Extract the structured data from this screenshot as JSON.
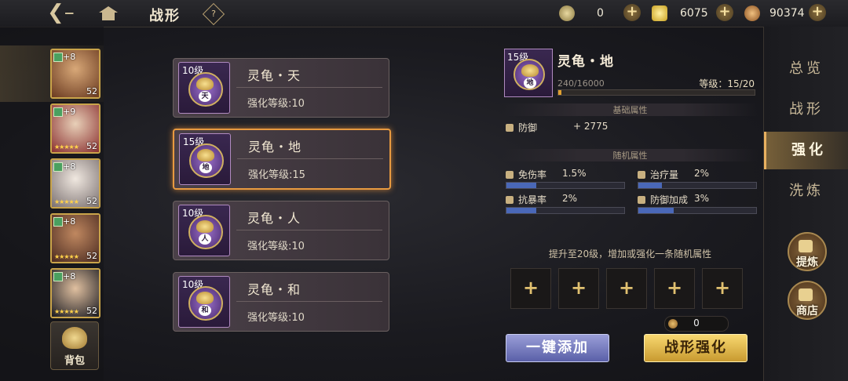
{
  "header": {
    "title": "战形",
    "help": "?",
    "currencies": [
      {
        "icon": "token-icon",
        "value": "0",
        "color": "#b0a070"
      },
      {
        "icon": "gold-ingot-icon",
        "value": "6075",
        "color": "#e8c040"
      },
      {
        "icon": "copper-coin-icon",
        "value": "90374",
        "color": "#c08040"
      }
    ]
  },
  "heroes": [
    {
      "bonus": "+8",
      "level": "52",
      "stars": "★★★★★",
      "color": "#b07a50",
      "selected": true
    },
    {
      "bonus": "+9",
      "level": "52",
      "stars": "★★★★★",
      "color": "#c0b8b0"
    },
    {
      "bonus": "+8",
      "level": "52",
      "stars": "★★★★★",
      "color": "#d8d0c8"
    },
    {
      "bonus": "+8",
      "level": "52",
      "stars": "★★★★★",
      "color": "#8a5a40"
    },
    {
      "bonus": "+8",
      "level": "52",
      "stars": "★★★★★",
      "color": "#4a3a40"
    }
  ],
  "bag": {
    "label": "背包"
  },
  "formations": [
    {
      "level": "10级",
      "char": "天",
      "name": "灵龟・天",
      "enhance": "强化等级:10"
    },
    {
      "level": "15级",
      "char": "地",
      "name": "灵龟・地",
      "enhance": "强化等级:15"
    },
    {
      "level": "10级",
      "char": "人",
      "name": "灵龟・人",
      "enhance": "强化等级:10"
    },
    {
      "level": "10级",
      "char": "和",
      "name": "灵龟・和",
      "enhance": "强化等级:10"
    }
  ],
  "detail": {
    "level": "15级",
    "char": "地",
    "name": "灵龟・地",
    "exp": "240/16000",
    "exp_fraction": 0.015,
    "grade": "等级：15/20",
    "base_title": "基础属性",
    "base_attr": {
      "name": "防御",
      "value": "+ 2775"
    },
    "random_title": "随机属性",
    "random_attrs": [
      {
        "name": "免伤率",
        "value": "1.5%",
        "fill": 0.25
      },
      {
        "name": "治疗量",
        "value": "2%",
        "fill": 0.2
      },
      {
        "name": "抗暴率",
        "value": "2%",
        "fill": 0.25
      },
      {
        "name": "防御加成",
        "value": "3%",
        "fill": 0.3
      }
    ],
    "hint": "提升至20级，增加或强化一条随机属性",
    "slot_symbol": "+",
    "cost": "0",
    "add_button": "一键添加",
    "enhance_button": "战形强化"
  },
  "tabs": [
    {
      "label": "总览"
    },
    {
      "label": "战形"
    },
    {
      "label": "强化",
      "active": true
    },
    {
      "label": "洗炼"
    }
  ],
  "side_buttons": [
    {
      "label": "提炼",
      "icon": "refine-cauldron-icon"
    },
    {
      "label": "商店",
      "icon": "shop-icon"
    }
  ]
}
